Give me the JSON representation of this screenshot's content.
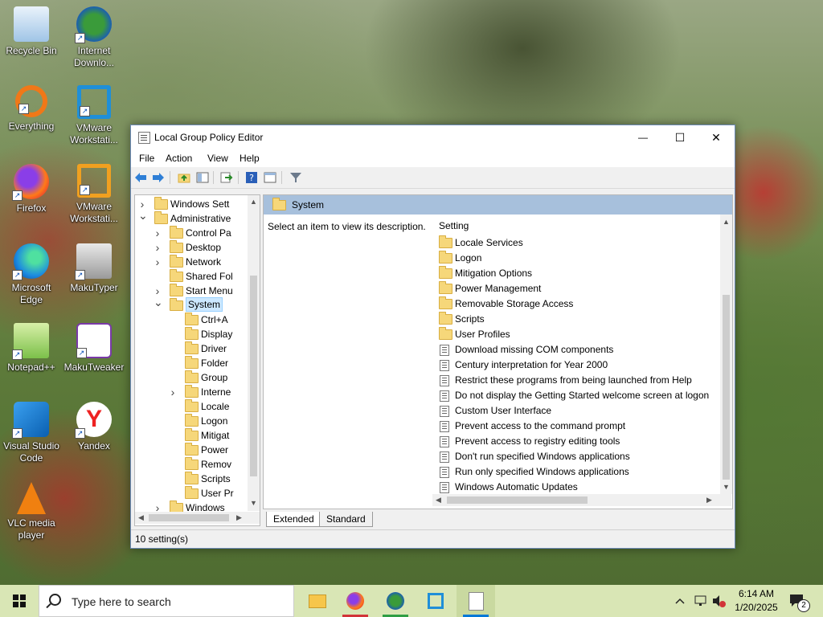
{
  "desktop": {
    "icons": [
      {
        "label": "Recycle Bin"
      },
      {
        "label": "Internet Downlo..."
      },
      {
        "label": "Everything"
      },
      {
        "label": "VMware Workstati..."
      },
      {
        "label": "Firefox"
      },
      {
        "label": "VMware Workstati..."
      },
      {
        "label": "Microsoft Edge"
      },
      {
        "label": "MakuTyper"
      },
      {
        "label": "Notepad++"
      },
      {
        "label": "MakuTweaker"
      },
      {
        "label": "Visual Studio Code"
      },
      {
        "label": "Yandex"
      },
      {
        "label": "VLC media player"
      }
    ]
  },
  "window": {
    "title": "Local Group Policy Editor",
    "minimize": "—",
    "maximize": "☐",
    "close": "✕",
    "menu": [
      "File",
      "Action",
      "View",
      "Help"
    ],
    "tree": [
      {
        "label": "Windows Sett",
        "chevron": "right"
      },
      {
        "label": "Administrative",
        "chevron": "down"
      },
      {
        "label": "Control Pa",
        "chevron": "right"
      },
      {
        "label": "Desktop",
        "chevron": "right"
      },
      {
        "label": "Network",
        "chevron": "right"
      },
      {
        "label": "Shared Fol",
        "chevron": "none"
      },
      {
        "label": "Start Menu",
        "chevron": "right"
      },
      {
        "label": "System",
        "chevron": "down",
        "selected": true
      },
      {
        "label": "Ctrl+A",
        "chevron": "none"
      },
      {
        "label": "Display",
        "chevron": "none"
      },
      {
        "label": "Driver",
        "chevron": "none"
      },
      {
        "label": "Folder",
        "chevron": "none"
      },
      {
        "label": "Group",
        "chevron": "none"
      },
      {
        "label": "Interne",
        "chevron": "right"
      },
      {
        "label": "Locale",
        "chevron": "none"
      },
      {
        "label": "Logon",
        "chevron": "none"
      },
      {
        "label": "Mitigat",
        "chevron": "none"
      },
      {
        "label": "Power",
        "chevron": "none"
      },
      {
        "label": "Remov",
        "chevron": "none"
      },
      {
        "label": "Scripts",
        "chevron": "none"
      },
      {
        "label": "User Pr",
        "chevron": "none"
      },
      {
        "label": "Windows",
        "chevron": "right"
      }
    ],
    "right": {
      "header": "System",
      "description": "Select an item to view its description.",
      "column": "Setting",
      "items": [
        {
          "type": "folder",
          "label": "Locale Services"
        },
        {
          "type": "folder",
          "label": "Logon"
        },
        {
          "type": "folder",
          "label": "Mitigation Options"
        },
        {
          "type": "folder",
          "label": "Power Management"
        },
        {
          "type": "folder",
          "label": "Removable Storage Access"
        },
        {
          "type": "folder",
          "label": "Scripts"
        },
        {
          "type": "folder",
          "label": "User Profiles"
        },
        {
          "type": "policy",
          "label": "Download missing COM components"
        },
        {
          "type": "policy",
          "label": "Century interpretation for Year 2000"
        },
        {
          "type": "policy",
          "label": "Restrict these programs from being launched from Help"
        },
        {
          "type": "policy",
          "label": "Do not display the Getting Started welcome screen at logon"
        },
        {
          "type": "policy",
          "label": "Custom User Interface"
        },
        {
          "type": "policy",
          "label": "Prevent access to the command prompt"
        },
        {
          "type": "policy",
          "label": "Prevent access to registry editing tools"
        },
        {
          "type": "policy",
          "label": "Don't run specified Windows applications"
        },
        {
          "type": "policy",
          "label": "Run only specified Windows applications"
        },
        {
          "type": "policy",
          "label": "Windows Automatic Updates"
        }
      ]
    },
    "tabs": [
      "Extended",
      "Standard"
    ],
    "status": "10 setting(s)"
  },
  "taskbar": {
    "search_placeholder": "Type here to search",
    "time": "6:14 AM",
    "date": "1/20/2025",
    "notifications": "2"
  },
  "colors": {
    "accent": "#0078d7",
    "pane_header": "#a7c0dc",
    "selection": "#cce8ff",
    "taskbar": "#d9e6b5"
  }
}
